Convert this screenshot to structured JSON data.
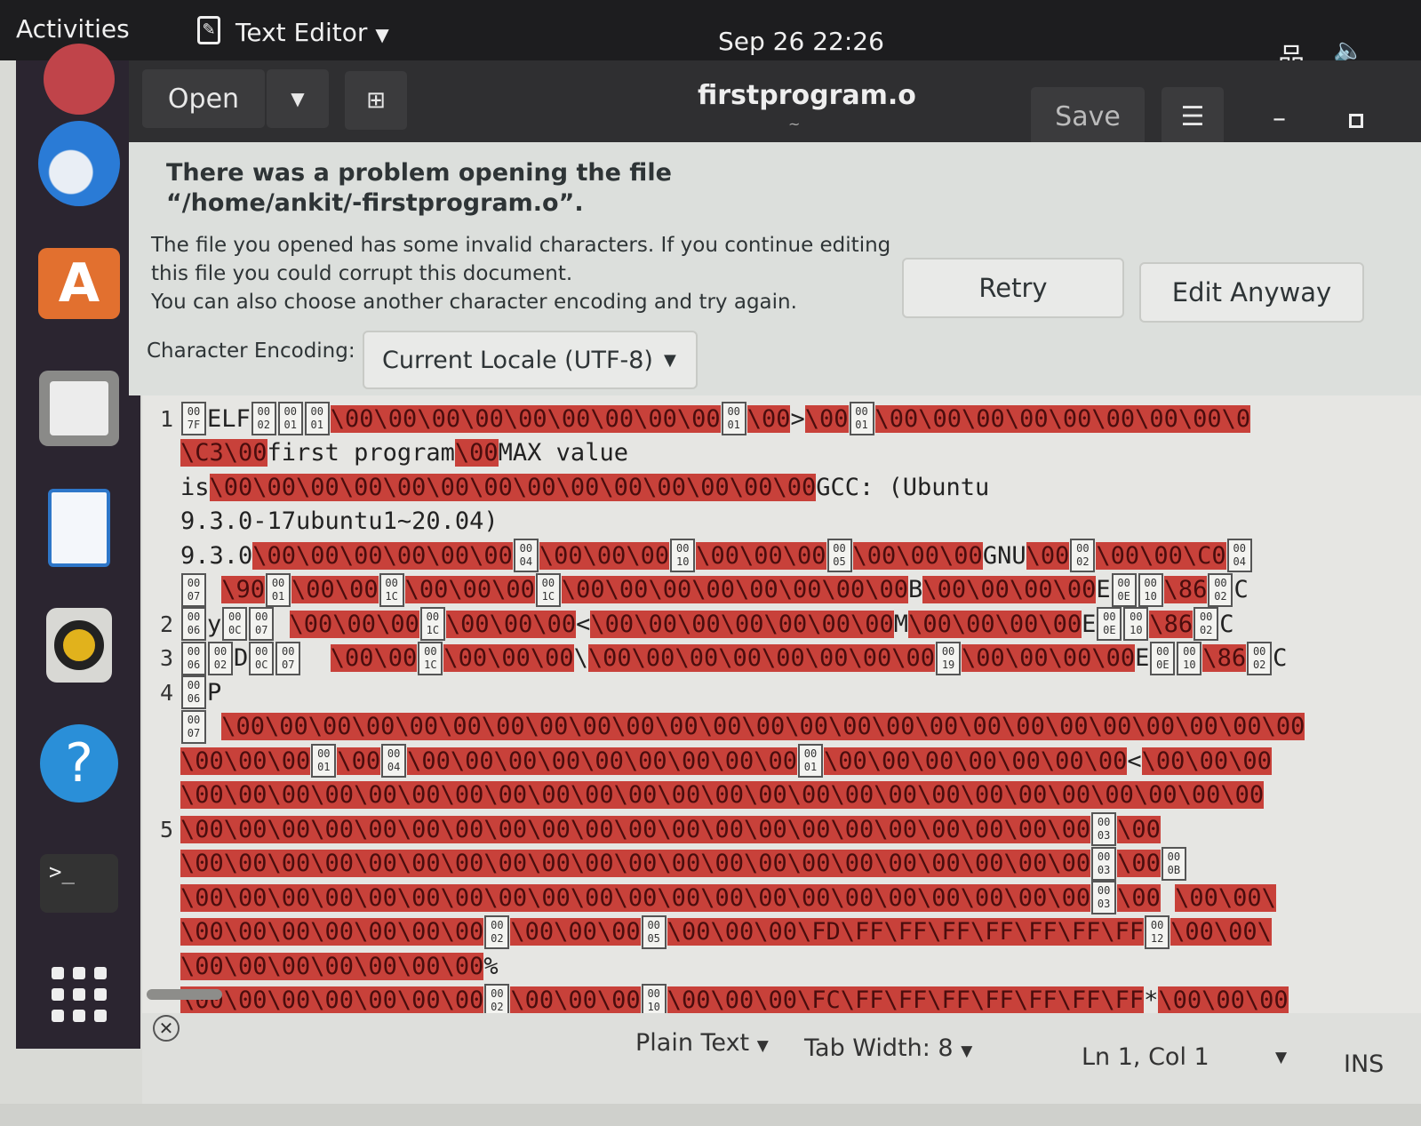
{
  "topbar": {
    "activities": "Activities",
    "app_name": "Text Editor",
    "clock": "Sep 26  22:26",
    "icons": [
      "network-icon",
      "volume-icon"
    ]
  },
  "dock": {
    "items": [
      "ubuntu-icon",
      "thunderbird-icon",
      "software-icon",
      "files-icon",
      "writer-icon",
      "rhythmbox-icon",
      "help-icon",
      "terminal-icon",
      "app-grid-icon"
    ]
  },
  "header": {
    "open_label": "Open",
    "title": "firstprogram.o",
    "subtitle": "~",
    "save_label": "Save"
  },
  "infobar": {
    "title": "There was a problem opening the file “/home/ankit/-firstprogram.o”.",
    "message_1": "The file you opened has some invalid characters. If you continue editing",
    "message_2": "this file you could corrupt this document.",
    "message_3": "You can also choose another character encoding and try again.",
    "retry_label": "Retry",
    "edit_anyway_label": "Edit Anyway",
    "encoding_label": "Character Encoding:",
    "encoding_value": "Current Locale (UTF-8)"
  },
  "colors": {
    "invalid_bg": "#c8413a",
    "topbar": "#1d1d1f",
    "dock": "#2b2530"
  },
  "editor": {
    "rows": [
      {
        "ln": "1",
        "segs": [
          [
            "h",
            "00",
            "7F"
          ],
          [
            "t",
            "ELF"
          ],
          [
            "h",
            "00",
            "02"
          ],
          [
            "h",
            "00",
            "01"
          ],
          [
            "h",
            "00",
            "01"
          ],
          [
            "i",
            "\\00\\00\\00\\00\\00\\00\\00\\00\\00"
          ],
          [
            "h",
            "00",
            "01"
          ],
          [
            "i",
            "\\00"
          ],
          [
            "t",
            ">"
          ],
          [
            "i",
            "\\00"
          ],
          [
            "h",
            "00",
            "01"
          ],
          [
            "i",
            "\\00\\00\\00\\00\\00\\00\\00\\00\\0"
          ]
        ]
      },
      {
        "ln": "",
        "segs": [
          [
            "i",
            "\\C3\\00"
          ],
          [
            "t",
            "first program"
          ],
          [
            "i",
            "\\00"
          ],
          [
            "t",
            "MAX value"
          ]
        ]
      },
      {
        "ln": "",
        "segs": [
          [
            "t",
            "is"
          ],
          [
            "i",
            "\\00\\00\\00\\00\\00\\00\\00\\00\\00\\00\\00\\00\\00\\00"
          ],
          [
            "t",
            "GCC: (Ubuntu"
          ]
        ]
      },
      {
        "ln": "",
        "segs": [
          [
            "t",
            "9.3.0-17ubuntu1~20.04)"
          ]
        ]
      },
      {
        "ln": "",
        "segs": [
          [
            "t",
            "9.3.0"
          ],
          [
            "i",
            "\\00\\00\\00\\00\\00\\00"
          ],
          [
            "h",
            "00",
            "04"
          ],
          [
            "i",
            "\\00\\00\\00"
          ],
          [
            "h",
            "00",
            "10"
          ],
          [
            "i",
            "\\00\\00\\00"
          ],
          [
            "h",
            "00",
            "05"
          ],
          [
            "i",
            "\\00\\00\\00"
          ],
          [
            "t",
            "GNU"
          ],
          [
            "i",
            "\\00"
          ],
          [
            "h",
            "00",
            "02"
          ],
          [
            "i",
            "\\00\\00\\C0"
          ],
          [
            "h",
            "00",
            "04"
          ]
        ]
      },
      {
        "ln": "",
        "segs": [
          [
            "h",
            "00",
            "07"
          ],
          [
            "t",
            " "
          ],
          [
            "i",
            "\\90"
          ],
          [
            "h",
            "00",
            "01"
          ],
          [
            "i",
            "\\00\\00"
          ],
          [
            "h",
            "00",
            "1C"
          ],
          [
            "i",
            "\\00\\00\\00"
          ],
          [
            "h",
            "00",
            "1C"
          ],
          [
            "i",
            "\\00\\00\\00\\00\\00\\00\\00\\00"
          ],
          [
            "t",
            "B"
          ],
          [
            "i",
            "\\00\\00\\00\\00"
          ],
          [
            "t",
            "E"
          ],
          [
            "h",
            "00",
            "0E"
          ],
          [
            "h",
            "00",
            "10"
          ],
          [
            "i",
            "\\86"
          ],
          [
            "h",
            "00",
            "02"
          ],
          [
            "t",
            "C"
          ]
        ]
      },
      {
        "ln": "2",
        "segs": [
          [
            "h",
            "00",
            "06"
          ],
          [
            "t",
            "y"
          ],
          [
            "h",
            "00",
            "0C"
          ],
          [
            "h",
            "00",
            "07"
          ],
          [
            "t",
            " "
          ],
          [
            "i",
            "\\00\\00\\00"
          ],
          [
            "h",
            "00",
            "1C"
          ],
          [
            "i",
            "\\00\\00\\00"
          ],
          [
            "t",
            "<"
          ],
          [
            "i",
            "\\00\\00\\00\\00\\00\\00\\00"
          ],
          [
            "t",
            "M"
          ],
          [
            "i",
            "\\00\\00\\00\\00"
          ],
          [
            "t",
            "E"
          ],
          [
            "h",
            "00",
            "0E"
          ],
          [
            "h",
            "00",
            "10"
          ],
          [
            "i",
            "\\86"
          ],
          [
            "h",
            "00",
            "02"
          ],
          [
            "t",
            "C"
          ]
        ]
      },
      {
        "ln": "3",
        "segs": [
          [
            "h",
            "00",
            "06"
          ],
          [
            "h",
            "00",
            "02"
          ],
          [
            "t",
            "D"
          ],
          [
            "h",
            "00",
            "0C"
          ],
          [
            "h",
            "00",
            "07"
          ],
          [
            "t",
            "  "
          ],
          [
            "i",
            "\\00\\00"
          ],
          [
            "h",
            "00",
            "1C"
          ],
          [
            "i",
            "\\00\\00\\00"
          ],
          [
            "t",
            "\\"
          ],
          [
            "i",
            "\\00\\00\\00\\00\\00\\00\\00\\00"
          ],
          [
            "h",
            "00",
            "19"
          ],
          [
            "i",
            "\\00\\00\\00\\00"
          ],
          [
            "t",
            "E"
          ],
          [
            "h",
            "00",
            "0E"
          ],
          [
            "h",
            "00",
            "10"
          ],
          [
            "i",
            "\\86"
          ],
          [
            "h",
            "00",
            "02"
          ],
          [
            "t",
            "C"
          ]
        ]
      },
      {
        "ln": "4",
        "segs": [
          [
            "h",
            "00",
            "06"
          ],
          [
            "t",
            "P"
          ]
        ]
      },
      {
        "ln": "",
        "segs": [
          [
            "h",
            "00",
            "07"
          ],
          [
            "t",
            " "
          ],
          [
            "i",
            "\\00\\00\\00\\00\\00\\00\\00\\00\\00\\00\\00\\00\\00\\00\\00\\00\\00\\00\\00\\00\\00\\00\\00\\00\\00"
          ]
        ]
      },
      {
        "ln": "",
        "segs": [
          [
            "i",
            "\\00\\00\\00"
          ],
          [
            "h",
            "00",
            "01"
          ],
          [
            "i",
            "\\00"
          ],
          [
            "h",
            "00",
            "04"
          ],
          [
            "i",
            "\\00\\00\\00\\00\\00\\00\\00\\00\\00"
          ],
          [
            "h",
            "00",
            "01"
          ],
          [
            "i",
            "\\00\\00\\00\\00\\00\\00\\00"
          ],
          [
            "t",
            "<"
          ],
          [
            "i",
            "\\00\\00\\00"
          ]
        ]
      },
      {
        "ln": "",
        "segs": [
          [
            "i",
            "\\00\\00\\00\\00\\00\\00\\00\\00\\00\\00\\00\\00\\00\\00\\00\\00\\00\\00\\00\\00\\00\\00\\00\\00\\00"
          ]
        ]
      },
      {
        "ln": "5",
        "segs": [
          [
            "i",
            "\\00\\00\\00\\00\\00\\00\\00\\00\\00\\00\\00\\00\\00\\00\\00\\00\\00\\00\\00\\00\\00"
          ],
          [
            "h",
            "00",
            "03"
          ],
          [
            "i",
            "\\00"
          ]
        ]
      },
      {
        "ln": "",
        "segs": [
          [
            "i",
            "\\00\\00\\00\\00\\00\\00\\00\\00\\00\\00\\00\\00\\00\\00\\00\\00\\00\\00\\00\\00\\00"
          ],
          [
            "h",
            "00",
            "03"
          ],
          [
            "i",
            "\\00"
          ],
          [
            "h",
            "00",
            "0B"
          ]
        ]
      },
      {
        "ln": "",
        "segs": [
          [
            "i",
            "\\00\\00\\00\\00\\00\\00\\00\\00\\00\\00\\00\\00\\00\\00\\00\\00\\00\\00\\00\\00\\00"
          ],
          [
            "h",
            "00",
            "03"
          ],
          [
            "i",
            "\\00"
          ],
          [
            "t",
            " "
          ],
          [
            "i",
            "\\00\\00\\"
          ]
        ]
      },
      {
        "ln": "",
        "segs": [
          [
            "i",
            "\\00\\00\\00\\00\\00\\00\\00"
          ],
          [
            "h",
            "00",
            "02"
          ],
          [
            "i",
            "\\00\\00\\00"
          ],
          [
            "h",
            "00",
            "05"
          ],
          [
            "i",
            "\\00\\00\\00\\FD\\FF\\FF\\FF\\FF\\FF\\FF\\FF"
          ],
          [
            "h",
            "00",
            "12"
          ],
          [
            "i",
            "\\00\\00\\"
          ]
        ]
      },
      {
        "ln": "",
        "segs": [
          [
            "i",
            "\\00\\00\\00\\00\\00\\00\\00"
          ],
          [
            "t",
            "%"
          ]
        ]
      },
      {
        "ln": "",
        "segs": [
          [
            "i",
            "\\00\\00\\00\\00\\00\\00\\00"
          ],
          [
            "h",
            "00",
            "02"
          ],
          [
            "i",
            "\\00\\00\\00"
          ],
          [
            "h",
            "00",
            "10"
          ],
          [
            "i",
            "\\00\\00\\00\\FC\\FF\\FF\\FF\\FF\\FF\\FF\\FF"
          ],
          [
            "t",
            "*"
          ],
          [
            "i",
            "\\00\\00\\00"
          ]
        ]
      }
    ]
  },
  "statusbar": {
    "language": "Plain Text",
    "tab_width": "Tab Width: 8",
    "position": "Ln 1, Col 1",
    "mode": "INS"
  }
}
